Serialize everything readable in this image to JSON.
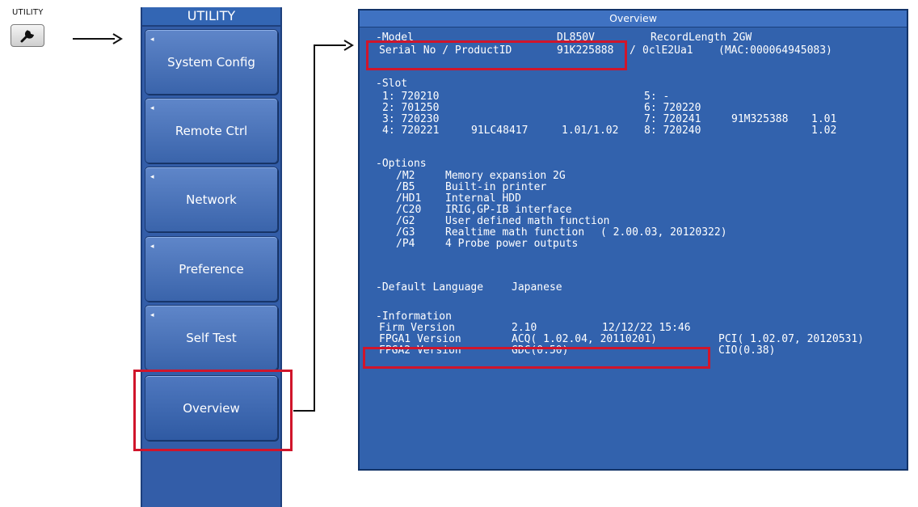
{
  "utility_key": {
    "label": "UTILITY",
    "icon": "wrench-icon"
  },
  "menu": {
    "title": "UTILITY",
    "items": [
      {
        "label": "System Config"
      },
      {
        "label": "Remote Ctrl"
      },
      {
        "label": "Network"
      },
      {
        "label": "Preference"
      },
      {
        "label": "Self Test"
      },
      {
        "label": "Overview"
      }
    ],
    "submenu_indicator": "◂"
  },
  "overview": {
    "title": "Overview",
    "model": {
      "label": "-Model",
      "value": "DL850V",
      "record_length": "RecordLength 2GW"
    },
    "serial": {
      "label": "Serial No / ProductID",
      "serial": "91K225888",
      "sep": "/",
      "product_id": "0clE2Ua1",
      "mac": "(MAC:000064945083)"
    },
    "slot": {
      "label": "-Slot",
      "rows": [
        {
          "left": "1: 720210",
          "left_serial": "",
          "left_ver": "",
          "right": "5: -",
          "right_serial": "",
          "right_ver": ""
        },
        {
          "left": "2: 701250",
          "left_serial": "",
          "left_ver": "",
          "right": "6: 720220",
          "right_serial": "",
          "right_ver": ""
        },
        {
          "left": "3: 720230",
          "left_serial": "",
          "left_ver": "",
          "right": "7: 720241",
          "right_serial": "91M325388",
          "right_ver": "1.01"
        },
        {
          "left": "4: 720221",
          "left_serial": "91LC48417",
          "left_ver": "1.01/1.02",
          "right": "8: 720240",
          "right_serial": "",
          "right_ver": "1.02"
        }
      ]
    },
    "options": {
      "label": "-Options",
      "items": [
        {
          "code": "/M2",
          "desc": "Memory expansion 2G"
        },
        {
          "code": "/B5",
          "desc": "Built-in printer"
        },
        {
          "code": "/HD1",
          "desc": "Internal HDD"
        },
        {
          "code": "/C20",
          "desc": "IRIG,GP-IB interface"
        },
        {
          "code": "/G2",
          "desc": "User defined math function"
        },
        {
          "code": "/G3",
          "desc": "Realtime math function",
          "extra": "( 2.00.03, 20120322)"
        },
        {
          "code": "/P4",
          "desc": "4 Probe power outputs"
        }
      ]
    },
    "language": {
      "label": "-Default Language",
      "value": "Japanese"
    },
    "information": {
      "label": "-Information",
      "firm": {
        "label": "Firm Version",
        "version": "2.10",
        "date": "12/12/22 15:46"
      },
      "fpga1": {
        "label": "FPGA1 Version",
        "acq": "ACQ( 1.02.04, 20110201)",
        "pci": "PCI( 1.02.07, 20120531)"
      },
      "fpga2": {
        "label": "FPGA2 Version",
        "gdc": "GDC(0.50)",
        "cio": "CIO(0.38)"
      }
    }
  },
  "colors": {
    "screen_bg": "#3262ad",
    "highlight": "#d0152b",
    "menu_bg": "#335da8"
  }
}
